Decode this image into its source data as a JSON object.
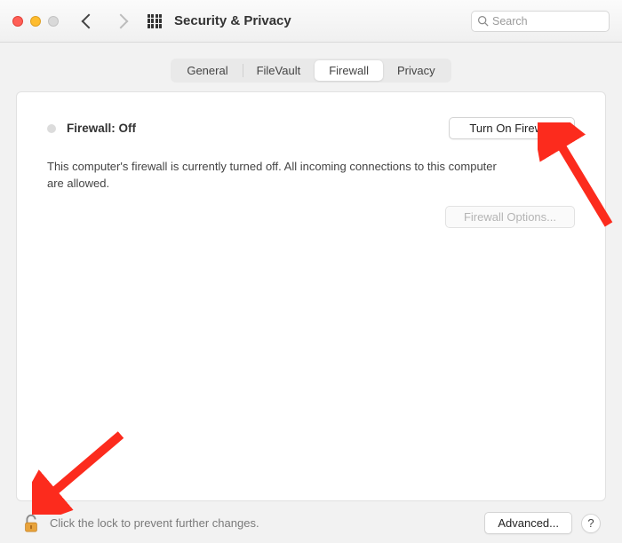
{
  "window": {
    "title": "Security & Privacy",
    "search_placeholder": "Search"
  },
  "tabs": {
    "general": "General",
    "filevault": "FileVault",
    "firewall": "Firewall",
    "privacy": "Privacy",
    "active": "firewall"
  },
  "firewall": {
    "status_title": "Firewall: Off",
    "turn_on_label": "Turn On Firewall",
    "description": "This computer's firewall is currently turned off. All incoming connections to this computer are allowed.",
    "options_label": "Firewall Options..."
  },
  "footer": {
    "lock_text": "Click the lock to prevent further changes.",
    "advanced_label": "Advanced...",
    "help_label": "?"
  }
}
